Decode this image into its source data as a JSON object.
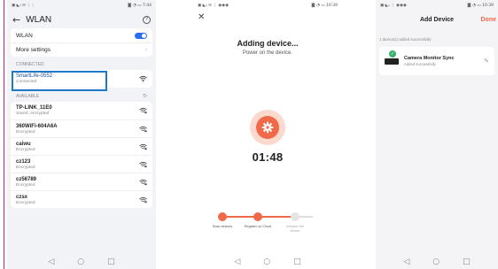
{
  "wlan_screen": {
    "status": {
      "left": "▣ ◣ᵢₗ ✉ ⋮⋮",
      "right": "◙ ◔ ▭ 7:44"
    },
    "title": "WLAN",
    "wlan_label": "WLAN",
    "wlan_enabled": true,
    "more_settings_label": "More settings",
    "connected_header": "CONNECTED",
    "connected_network": {
      "name": "SmartLife-0552",
      "status": "Connected"
    },
    "available_header": "AVAILABLE",
    "available_networks": [
      {
        "name": "TP-LINK_11E0",
        "status": "Saved, encrypted"
      },
      {
        "name": "360WiFi-604A6A",
        "status": "Encrypted"
      },
      {
        "name": "caiwu",
        "status": "Encrypted"
      },
      {
        "name": "cz123",
        "status": "Encrypted"
      },
      {
        "name": "cz56789",
        "status": "Encrypted"
      },
      {
        "name": "czsx",
        "status": "Encrypted"
      }
    ]
  },
  "adding_screen": {
    "status": {
      "left": "▣ ◣ᵢₗ ✉ ⋮ ◉◉◉",
      "right": "◙ ◔ ▭ 10:39"
    },
    "title": "Adding device...",
    "subtitle": "Power on the device.",
    "timer": "01:48",
    "steps": [
      {
        "label": "Scan devices",
        "state": "done"
      },
      {
        "label": "Register on Cloud",
        "state": "done"
      },
      {
        "label": "Initialize the device",
        "state": "pending"
      }
    ],
    "colors": {
      "accent": "#f06a4a",
      "pending": "#dddddd"
    }
  },
  "added_screen": {
    "status": {
      "left": "▣ ◣ᵢₗ ⋮ ◉◉◉",
      "right": "◙ ◔ ▭ 10:39"
    },
    "title": "Add Device",
    "done_label": "Done",
    "count_text": "1 device(s) added successfully",
    "device": {
      "name": "Camera Monitor Sync",
      "status": "Added successfully"
    }
  },
  "nav": {
    "back": "◁",
    "home": "○",
    "recents": "□"
  }
}
